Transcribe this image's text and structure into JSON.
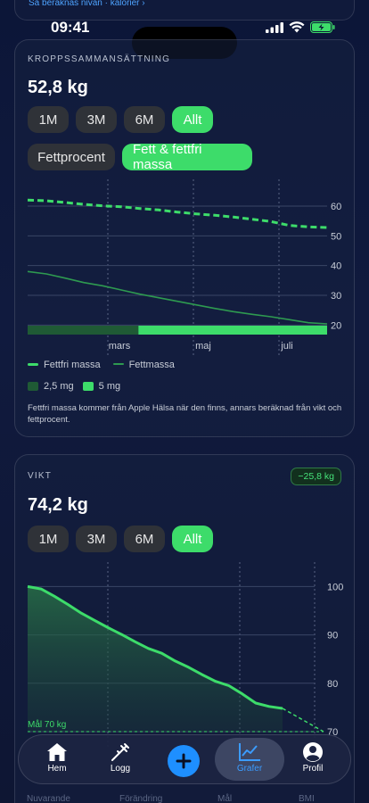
{
  "top_link": "Så beräknas nivån · kalorier",
  "status": {
    "time": "09:41"
  },
  "body_comp": {
    "label": "KROPPSSAMMANSÄTTNING",
    "value": "52,8 kg",
    "ranges": [
      "1M",
      "3M",
      "6M",
      "Allt"
    ],
    "active_range": "Allt",
    "modes": [
      "Fettprocent",
      "Fett & fettfri massa"
    ],
    "active_mode": "Fett & fettfri massa",
    "legend": {
      "lean": "Fettfri massa",
      "fat": "Fettmassa",
      "dose1": "2,5 mg",
      "dose2": "5 mg"
    },
    "note": "Fettfri massa kommer från Apple Hälsa när den finns, annars beräknad från vikt och fettprocent."
  },
  "weight": {
    "label": "VIKT",
    "badge": "−25,8 kg",
    "value": "74,2 kg",
    "ranges": [
      "1M",
      "3M",
      "6M",
      "Allt"
    ],
    "active_range": "Allt",
    "goal_label": "Mål 70 kg"
  },
  "bottom_labels": [
    "Nuvarande",
    "Förändring",
    "Mål",
    "BMI"
  ],
  "tabbar": {
    "home": "Hem",
    "log": "Logg",
    "charts": "Grafer",
    "profile": "Profil",
    "active": "Grafer"
  },
  "chart_data": [
    {
      "type": "line",
      "title": "",
      "y_ticks": [
        20,
        30,
        40,
        50,
        60
      ],
      "ylim": [
        18,
        63
      ],
      "x_ticks": [
        "mars",
        "maj",
        "juli"
      ],
      "series": [
        {
          "name": "Fettfri massa",
          "style": "dashed",
          "color": "#3ddc6a",
          "values": [
            62,
            61.8,
            61.2,
            60.6,
            60.1,
            59.8,
            59.2,
            58.7,
            58.0,
            57.4,
            56.9,
            56.3,
            55.6,
            54.8,
            53.5,
            53.0,
            52.8
          ]
        },
        {
          "name": "Fettmassa",
          "style": "solid",
          "color": "#2e9a50",
          "values": [
            38,
            37.2,
            35.8,
            34.3,
            33.2,
            31.8,
            30.4,
            29.2,
            28.0,
            26.8,
            25.6,
            24.5,
            23.6,
            22.8,
            21.8,
            20.8,
            20.4
          ]
        }
      ],
      "dose_periods": [
        {
          "dose": "2,5 mg",
          "from": 0,
          "to": 0.37,
          "color": "#1f5a35"
        },
        {
          "dose": "5 mg",
          "from": 0.37,
          "to": 1.0,
          "color": "#3ddc6a"
        }
      ],
      "grid": true
    },
    {
      "type": "area",
      "title": "",
      "y_ticks": [
        70,
        80,
        90,
        100
      ],
      "ylim": [
        70,
        101
      ],
      "series": [
        {
          "name": "Vikt",
          "color": "#3ddc6a",
          "values": [
            100,
            99.5,
            98,
            96.3,
            94.5,
            93,
            91.5,
            90.1,
            88.6,
            87.2,
            86.2,
            84.6,
            83.3,
            81.8,
            80.4,
            79.5,
            77.8,
            75.9,
            75.2,
            74.8
          ]
        }
      ],
      "goal": 70,
      "grid": true
    }
  ]
}
